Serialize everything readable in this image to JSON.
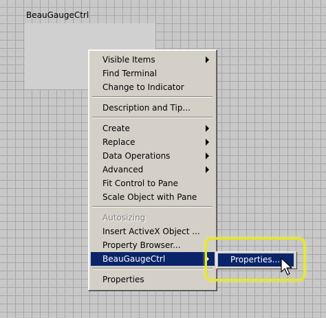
{
  "control": {
    "label": "BeauGaugeCtrl"
  },
  "menu": {
    "items": [
      {
        "label": "Visible Items",
        "submenu": true
      },
      {
        "label": "Find Terminal"
      },
      {
        "label": "Change to Indicator"
      },
      {
        "label": "Description and Tip..."
      },
      {
        "label": "Create",
        "submenu": true
      },
      {
        "label": "Replace",
        "submenu": true
      },
      {
        "label": "Data Operations",
        "submenu": true
      },
      {
        "label": "Advanced",
        "submenu": true
      },
      {
        "label": "Fit Control to Pane"
      },
      {
        "label": "Scale Object with Pane"
      },
      {
        "label": "Autosizing",
        "disabled": true
      },
      {
        "label": "Insert ActiveX Object ..."
      },
      {
        "label": "Property Browser..."
      },
      {
        "label": "BeauGaugeCtrl",
        "submenu": true,
        "selected": true
      },
      {
        "label": "Properties"
      }
    ]
  },
  "submenu": {
    "items": [
      {
        "label": "Properties...",
        "selected": true
      }
    ]
  },
  "colors": {
    "menu_background": "#d4d0c8",
    "selection": "#0a246a",
    "callout": "#e6ea1c"
  },
  "icons": {
    "cursor": "arrow-cursor-icon",
    "submenu_arrow": "submenu-arrow-icon"
  }
}
